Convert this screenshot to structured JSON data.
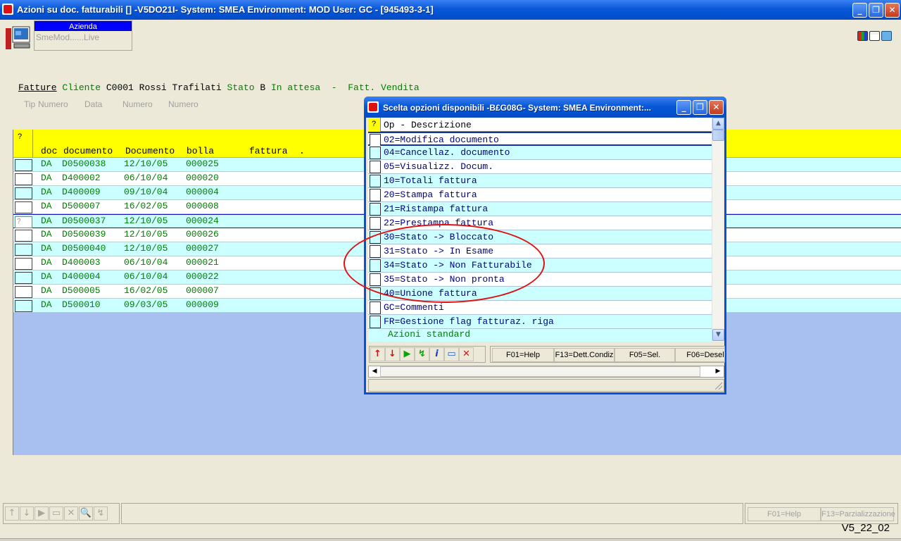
{
  "window": {
    "title": "Azioni su doc. fatturabili [] -V5DO21I- System: SMEA Environment: MOD User: GC - [945493-3-1]",
    "minimize_glyph": "_",
    "maximize_glyph": "❐",
    "close_glyph": "✕"
  },
  "toolbar": {
    "azienda_label": "Azienda",
    "azienda_value": "SmeMod......Live"
  },
  "heading": {
    "fatture": "Fatture",
    "cliente_label": "Cliente",
    "cliente_code": "C0001",
    "cliente_name": "Rossi Trafilati",
    "stato_label": "Stato",
    "stato_code": "B",
    "stato_desc": "In attesa",
    "dash": "-",
    "tipo": "Fatt. Vendita"
  },
  "subheader": {
    "tip": "Tip",
    "numero1": "Numero",
    "data": "Data",
    "numero2": "Numero",
    "numero3": "Numero"
  },
  "grid": {
    "head_q": "?",
    "columns": [
      "doc",
      "documento",
      "Documento",
      "bolla",
      "fattura",
      "."
    ],
    "rows": [
      {
        "doc": "DA",
        "documento": "D0500038",
        "data": "12/10/05",
        "bolla": "000025"
      },
      {
        "doc": "DA",
        "documento": "D400002",
        "data": "06/10/04",
        "bolla": "000020"
      },
      {
        "doc": "DA",
        "documento": "D400009",
        "data": "09/10/04",
        "bolla": "000004"
      },
      {
        "doc": "DA",
        "documento": "D500007",
        "data": "16/02/05",
        "bolla": "000008"
      },
      {
        "doc": "DA",
        "documento": "D0500037",
        "data": "12/10/05",
        "bolla": "000024",
        "mark": "?"
      },
      {
        "doc": "DA",
        "documento": "D0500039",
        "data": "12/10/05",
        "bolla": "000026"
      },
      {
        "doc": "DA",
        "documento": "D0500040",
        "data": "12/10/05",
        "bolla": "000027"
      },
      {
        "doc": "DA",
        "documento": "D400003",
        "data": "06/10/04",
        "bolla": "000021"
      },
      {
        "doc": "DA",
        "documento": "D400004",
        "data": "06/10/04",
        "bolla": "000022"
      },
      {
        "doc": "DA",
        "documento": "D500005",
        "data": "16/02/05",
        "bolla": "000007"
      },
      {
        "doc": "DA",
        "documento": "D500010",
        "data": "09/03/05",
        "bolla": "000009"
      }
    ]
  },
  "bottom": {
    "nav_icons": [
      "↑",
      "↓",
      "▶",
      "▭",
      "✕",
      "🔍",
      "↯"
    ],
    "f01": "F01=Help",
    "f13": "F13=Parzializzazione",
    "version": "V5_22_02"
  },
  "popup": {
    "title": "Scelta opzioni disponibili -B£G08G- System: SMEA Environment:...",
    "head_q": "?",
    "head_text": "Op - Descrizione",
    "options": [
      "02=Modifica documento",
      "04=Cancellaz. documento",
      "05=Visualizz. Docum.",
      "10=Totali fattura",
      "20=Stampa fattura",
      "21=Ristampa fattura",
      "22=Prestampa fattura",
      "30=Stato -> Bloccato",
      "31=Stato -> In Esame",
      "34=Stato -> Non Fatturabile",
      "35=Stato -> Non pronta",
      "40=Unione fattura",
      "GC=Commenti",
      "FR=Gestione flag fatturaz. riga"
    ],
    "group_label": "Azioni standard",
    "scroll_up": "▲",
    "scroll_down": "▼",
    "scroll_left": "◀",
    "scroll_right": "▶",
    "tools": [
      "↑",
      "↓",
      "▶",
      "↯",
      "i",
      "▭",
      "✕"
    ],
    "fkeys": [
      "F01=Help",
      "F13=Dett.Condiz",
      "F05=Sel.",
      "F06=Desel"
    ]
  }
}
